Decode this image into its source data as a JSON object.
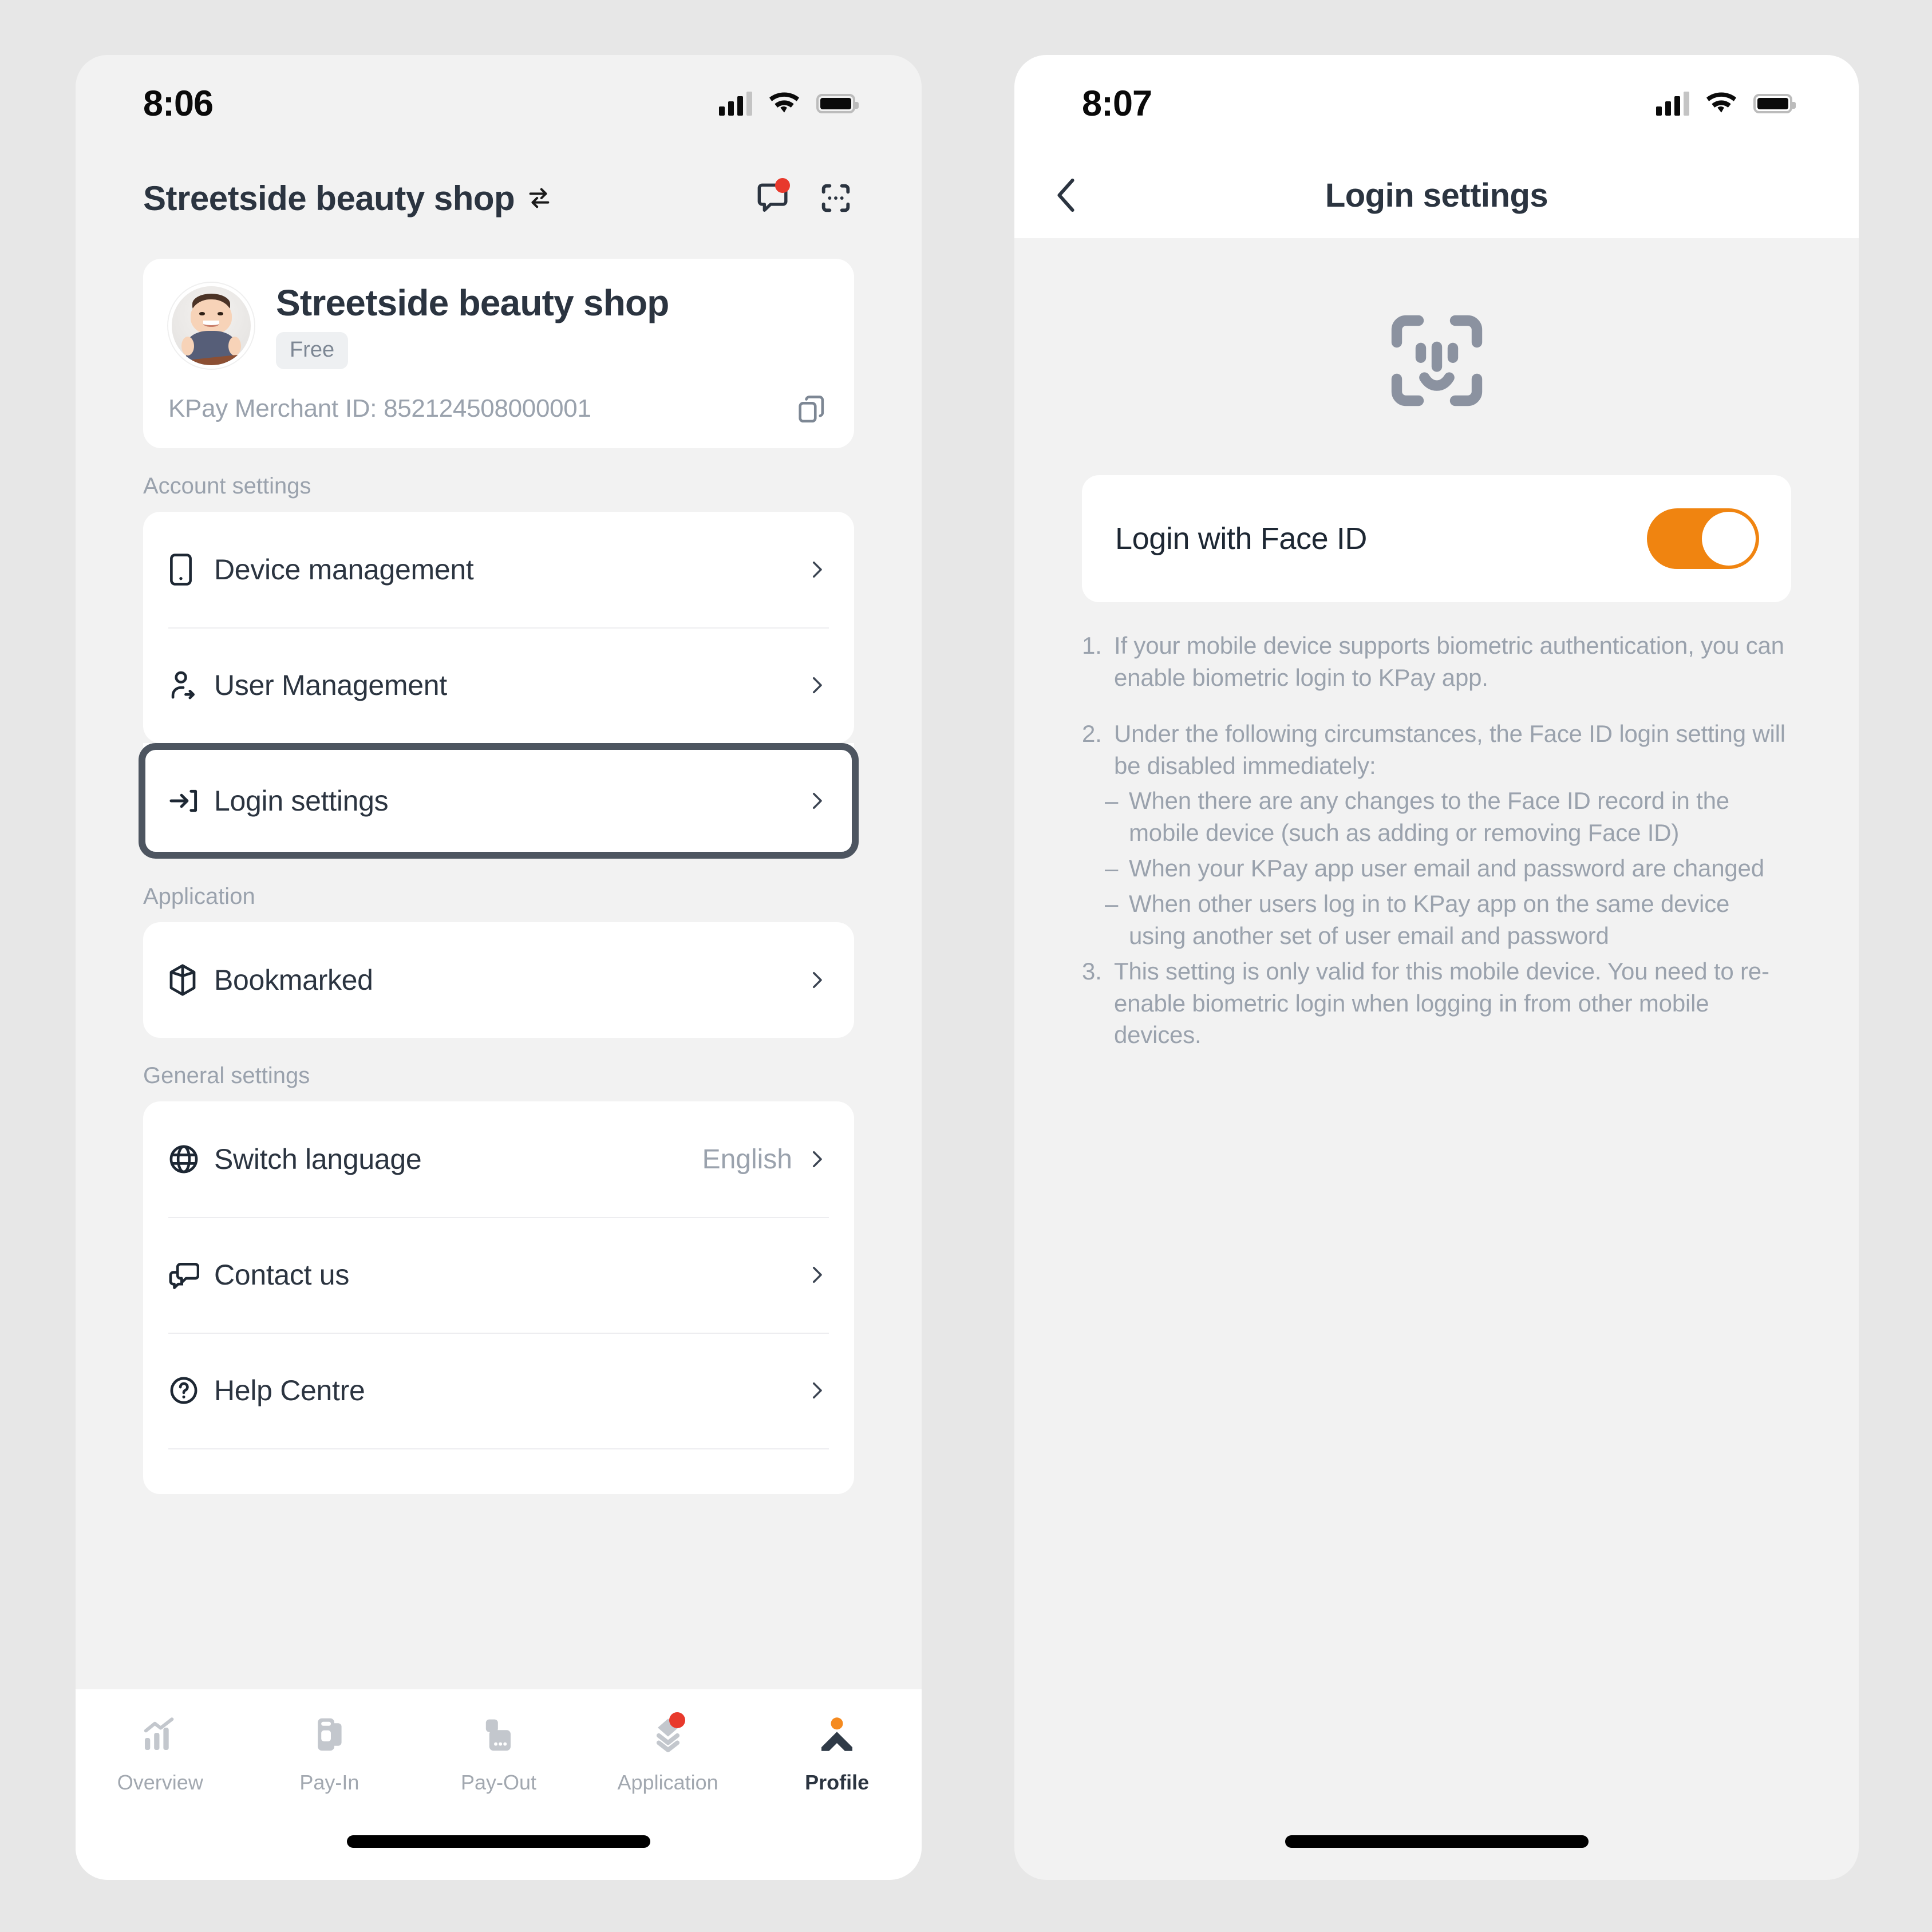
{
  "left_phone": {
    "status": {
      "time": "8:06"
    },
    "header": {
      "shop_name": "Streetside beauty shop",
      "switch_icon": "switch-arrows-icon",
      "chat_icon": "chat-bubble-icon",
      "scan_icon": "scan-qr-icon"
    },
    "profile_card": {
      "shop_name": "Streetside beauty shop",
      "plan_badge": "Free",
      "merchant_id": "KPay Merchant ID: 852124508000001",
      "copy_icon": "copy-icon",
      "avatar_icon": "avatar"
    },
    "sections": [
      {
        "label": "Account settings",
        "items": [
          {
            "label": "Device management",
            "icon": "mobile-device-icon",
            "value": ""
          },
          {
            "label": "User Management",
            "icon": "user-add-icon",
            "value": ""
          }
        ]
      },
      {
        "label": "Application",
        "items": [
          {
            "label": "Bookmarked",
            "icon": "cube-bookmark-icon",
            "value": ""
          }
        ]
      },
      {
        "label": "General settings",
        "items": [
          {
            "label": "Switch language",
            "icon": "globe-icon",
            "value": "English"
          },
          {
            "label": "Contact us",
            "icon": "chat-support-icon",
            "value": ""
          },
          {
            "label": "Help Centre",
            "icon": "question-circle-icon",
            "value": ""
          }
        ]
      }
    ],
    "highlighted_item": {
      "label": "Login settings",
      "icon": "login-arrow-icon"
    },
    "tabbar": [
      {
        "label": "Overview",
        "icon": "chart-bars-icon",
        "active": false,
        "badge": false
      },
      {
        "label": "Pay-In",
        "icon": "card-reader-icon",
        "active": false,
        "badge": false
      },
      {
        "label": "Pay-Out",
        "icon": "terminal-icon",
        "active": false,
        "badge": false
      },
      {
        "label": "Application",
        "icon": "chevrons-down-icon",
        "active": false,
        "badge": true
      },
      {
        "label": "Profile",
        "icon": "person-peak-icon",
        "active": true,
        "badge": false
      }
    ]
  },
  "right_phone": {
    "status": {
      "time": "8:07"
    },
    "nav": {
      "title": "Login settings",
      "back_icon": "chevron-left-icon"
    },
    "hero_icon": "face-id-icon",
    "toggle": {
      "label": "Login with Face ID",
      "state": "on"
    },
    "notes": [
      {
        "num": "1.",
        "text": "If your mobile device supports biometric authentication, you can enable biometric login to KPay app.",
        "sub": false,
        "gap": false
      },
      {
        "num": "2.",
        "text": "Under the following circumstances, the Face ID login setting will be disabled immediately:",
        "sub": false,
        "gap": true
      },
      {
        "num": "–",
        "text": "When there are any changes to the Face ID record in the mobile device (such as adding or removing Face ID)",
        "sub": true,
        "gap": false
      },
      {
        "num": "–",
        "text": "When your KPay app user email and password are changed",
        "sub": true,
        "gap": false
      },
      {
        "num": "–",
        "text": "When other users log in to KPay app on the same device using another set of user email and password",
        "sub": true,
        "gap": false
      },
      {
        "num": "3.",
        "text": "This setting is only valid for this mobile device. You need to re-enable biometric login when logging in from other mobile devices.",
        "sub": false,
        "gap": false
      }
    ]
  },
  "colors": {
    "page_bg": "#e7e7e7",
    "screen_bg": "#f2f2f2",
    "card_bg": "#ffffff",
    "text_primary": "#2b3440",
    "text_muted": "#9aa2ad",
    "accent_orange": "#F08410",
    "badge_red": "#e8392c",
    "highlight_ring": "#4d5560"
  }
}
